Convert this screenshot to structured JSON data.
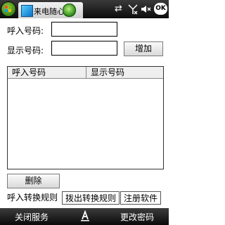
{
  "window": {
    "title": "来电随心",
    "ok_label": "OK"
  },
  "form": {
    "incoming_label": "呼入号码:",
    "display_label": "显示号码:",
    "incoming_value": "",
    "display_value": "",
    "add_button": "增加"
  },
  "list": {
    "columns": [
      "呼入号码",
      "显示号码"
    ]
  },
  "delete_button": "删除",
  "tabs": [
    "呼入转换规则",
    "拨出转换规则",
    "注册软件"
  ],
  "softkeys": {
    "left": "关闭服务",
    "right": "更改密码"
  },
  "icons": {
    "start": "windows-flag-icon",
    "app": "app-icon",
    "phone": "phone-icon",
    "connectivity": "data-arrows-icon",
    "signal": "signal-icon",
    "volume": "volume-icon",
    "keyboard": "keyboard-icon"
  }
}
